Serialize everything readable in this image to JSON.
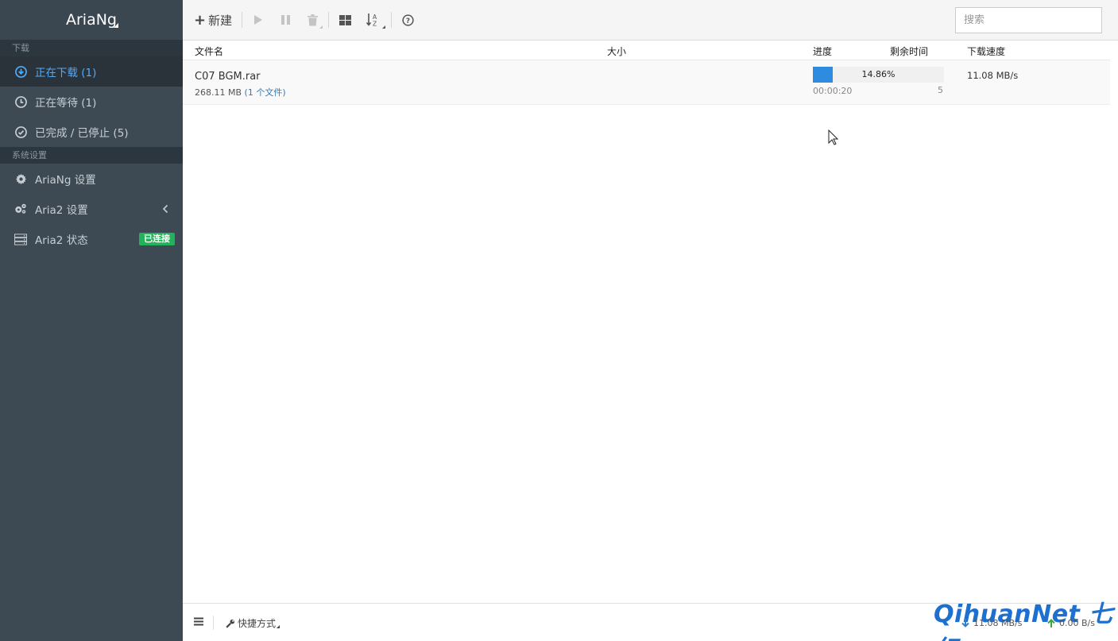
{
  "sidebar": {
    "brand": "AriaNg",
    "sections": [
      {
        "header": "下载"
      },
      {
        "header": "系统设置"
      }
    ],
    "items": [
      {
        "label": "正在下载 (1)",
        "icon": "download-circle-icon"
      },
      {
        "label": "正在等待 (1)",
        "icon": "clock-icon"
      },
      {
        "label": "已完成 / 已停止 (5)",
        "icon": "check-circle-icon"
      },
      {
        "label": "AriaNg 设置",
        "icon": "gear-icon"
      },
      {
        "label": "Aria2 设置",
        "icon": "gears-icon"
      },
      {
        "label": "Aria2 状态",
        "icon": "server-icon",
        "badge": "已连接"
      }
    ]
  },
  "toolbar": {
    "new_label": "新建",
    "search_placeholder": "搜索"
  },
  "table": {
    "columns": [
      "文件名",
      "大小",
      "进度",
      "剩余时间",
      "下载速度"
    ],
    "rows": [
      {
        "name": "C07 BGM.rar",
        "size": "268.11 MB",
        "files": "(1 个文件)",
        "progress_text": "14.86%",
        "progress": 14.86,
        "time_left": "00:00:20",
        "connections": "5",
        "speed": "11.08 MB/s"
      }
    ]
  },
  "footer": {
    "shortcut_label": "快捷方式",
    "download_speed": "11.08 MB/s",
    "upload_speed": "0.00 B/s",
    "watermark": "QihuanNet 七幻"
  },
  "colors": {
    "sidebar_bg": "#3d4a54",
    "active_text": "#56a8f5",
    "badge_bg": "#22b35a",
    "progress_fill": "#2e8ce0",
    "watermark": "#1d6fd0"
  }
}
